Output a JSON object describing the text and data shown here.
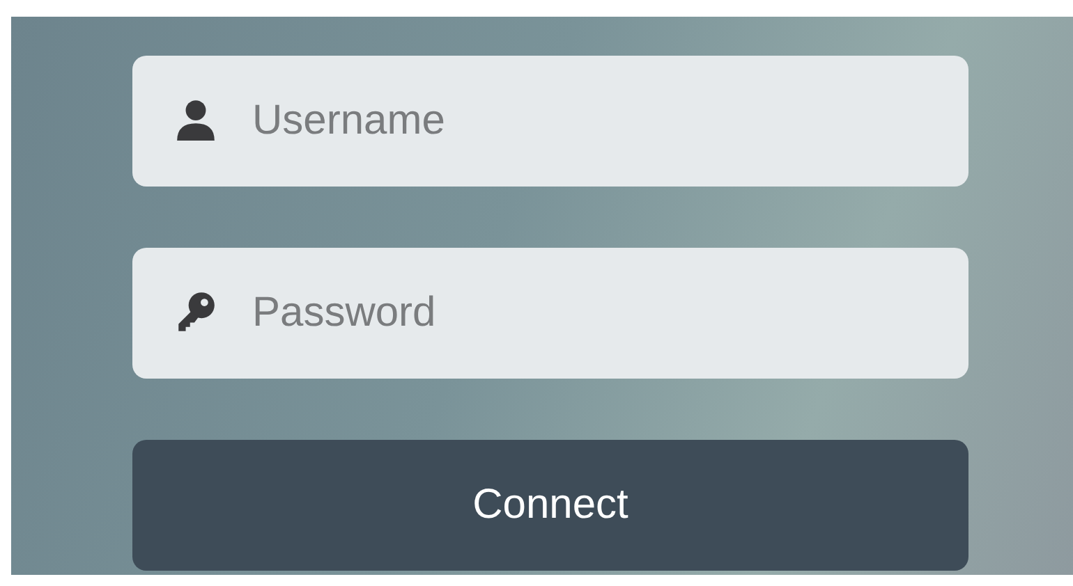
{
  "fields": [
    {
      "kind": "user",
      "placeholder": "Username"
    },
    {
      "kind": "key",
      "placeholder": "Password"
    }
  ],
  "button": {
    "label": "Connect"
  }
}
